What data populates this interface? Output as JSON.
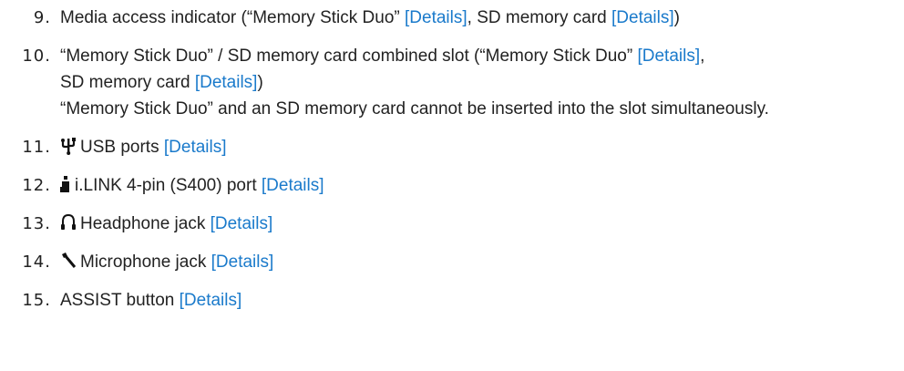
{
  "items": [
    {
      "num": "9.",
      "text": "Media access indicator (“Memory Stick Duo” ",
      "link1": "[Details]",
      "text2": ", SD memory card ",
      "link2": "[Details]",
      "text3": ")"
    },
    {
      "num": "10.",
      "text": "“Memory Stick Duo” / SD memory card combined slot (“Memory Stick Duo” ",
      "link1": "[Details]",
      "text2": ",",
      "line2a": "SD memory card ",
      "link2": "[Details]",
      "line2b": ")",
      "note": "“Memory Stick Duo” and an SD memory card cannot be inserted into the slot simultaneously."
    },
    {
      "num": "11.",
      "icon": "usb-icon",
      "text": "USB ports ",
      "link": "[Details]"
    },
    {
      "num": "12.",
      "icon": "ilink-icon",
      "text": "i.LINK 4-pin (S400) port ",
      "link": "[Details]"
    },
    {
      "num": "13.",
      "icon": "headphone-icon",
      "text": "Headphone jack ",
      "link": "[Details]"
    },
    {
      "num": "14.",
      "icon": "microphone-icon",
      "text": "Microphone jack ",
      "link": "[Details]"
    },
    {
      "num": "15.",
      "text": "ASSIST button ",
      "link": "[Details]"
    }
  ],
  "colors": {
    "link": "#1a7acb",
    "text": "#222222"
  }
}
